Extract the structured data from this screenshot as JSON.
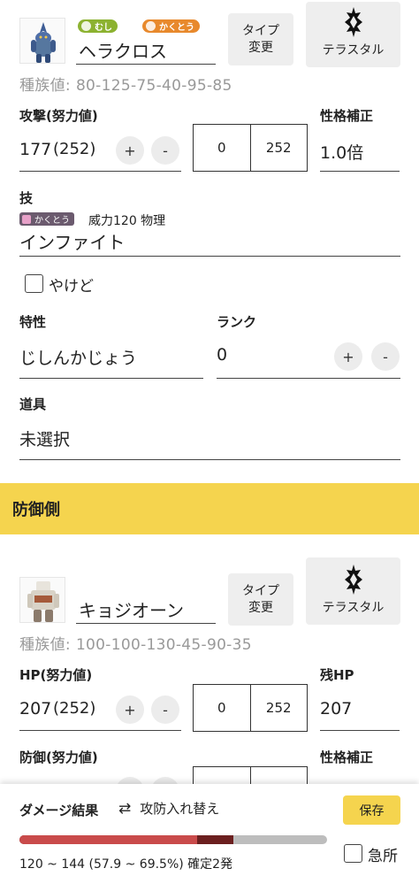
{
  "attacker": {
    "types": [
      "むし",
      "かくとう"
    ],
    "name": "ヘラクロス",
    "type_change": [
      "タイプ",
      "変更"
    ],
    "terastal_label": "テラスタル",
    "base_stats_label": "種族値:",
    "base_stats": "80-125-75-40-95-85",
    "attack": {
      "label": "攻撃(努力値)",
      "value": "177",
      "ev": "(252)",
      "plus": "+",
      "minus": "-",
      "ev_min": "0",
      "ev_max": "252"
    },
    "nature": {
      "label": "性格補正",
      "value": "1.0倍"
    },
    "move": {
      "label": "技",
      "type": "かくとう",
      "info": "威力120 物理",
      "name": "インファイト"
    },
    "burn_label": "やけど",
    "ability": {
      "label": "特性",
      "value": "じしんかじょう"
    },
    "rank": {
      "label": "ランク",
      "value": "0",
      "plus": "+",
      "minus": "-"
    },
    "item": {
      "label": "道具",
      "value": "未選択"
    }
  },
  "defender_section_title": "防御側",
  "defender": {
    "name": "キョジオーン",
    "type_change": [
      "タイプ",
      "変更"
    ],
    "terastal_label": "テラスタル",
    "base_stats_label": "種族値:",
    "base_stats": "100-100-130-45-90-35",
    "hp": {
      "label": "HP(努力値)",
      "value": "207",
      "ev": "(252)",
      "plus": "+",
      "minus": "-",
      "ev_min": "0",
      "ev_max": "252"
    },
    "remaining_hp": {
      "label": "残HP",
      "value": "207"
    },
    "defense": {
      "label": "防御(努力値)"
    },
    "nature": {
      "label": "性格補正"
    }
  },
  "footer": {
    "title": "ダメージ結果",
    "swap_icon": "⇄",
    "swap_label": "攻防入れ替え",
    "save_label": "保存",
    "result": "120 ~ 144 (57.9 ~ 69.5%) 確定2発",
    "critical_label": "急所",
    "damage_min_pct": 57.9,
    "damage_max_pct": 69.5,
    "colors": {
      "min": "#c94b4b",
      "max": "#6b1f1f",
      "track": "#bdbdbd"
    }
  }
}
